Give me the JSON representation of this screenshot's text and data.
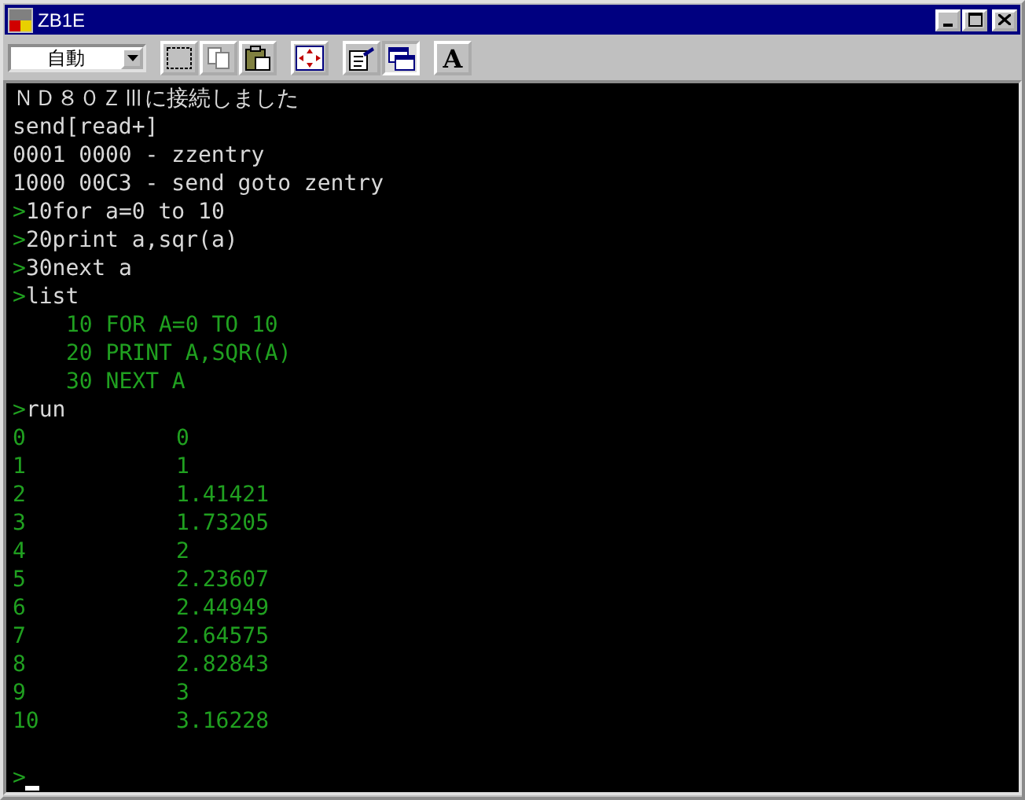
{
  "window": {
    "title": "ZB1E"
  },
  "toolbar": {
    "mode_dropdown": {
      "value": "自動"
    },
    "buttons": [
      {
        "kind": "select",
        "pressed": false
      },
      {
        "kind": "copy",
        "pressed": false
      },
      {
        "kind": "paste",
        "pressed": false
      },
      {
        "kind": "move",
        "pressed": false
      },
      {
        "kind": "properties",
        "pressed": false
      },
      {
        "kind": "window",
        "pressed": true
      },
      {
        "kind": "font",
        "label": "A",
        "pressed": false
      }
    ]
  },
  "terminal": {
    "lines": [
      {
        "kind": "system",
        "text": "ＮＤ８０ＺⅢに接続しました"
      },
      {
        "kind": "system",
        "text": "send[read+]"
      },
      {
        "kind": "system",
        "text": "0001 0000 - zzentry"
      },
      {
        "kind": "system",
        "text": "1000 00C3 - send goto zentry"
      },
      {
        "kind": "input",
        "prompt": ">",
        "text": "10for a=0 to 10"
      },
      {
        "kind": "input",
        "prompt": ">",
        "text": "20print a,sqr(a)"
      },
      {
        "kind": "input",
        "prompt": ">",
        "text": "30next a"
      },
      {
        "kind": "input",
        "prompt": ">",
        "text": "list"
      },
      {
        "kind": "listing",
        "text": "10 FOR A=0 TO 10"
      },
      {
        "kind": "listing",
        "text": "20 PRINT A,SQR(A)"
      },
      {
        "kind": "listing",
        "text": "30 NEXT A"
      },
      {
        "kind": "input",
        "prompt": ">",
        "text": "run"
      },
      {
        "kind": "output",
        "columns": [
          "0",
          "0"
        ]
      },
      {
        "kind": "output",
        "columns": [
          "1",
          "1"
        ]
      },
      {
        "kind": "output",
        "columns": [
          "2",
          "1.41421"
        ]
      },
      {
        "kind": "output",
        "columns": [
          "3",
          "1.73205"
        ]
      },
      {
        "kind": "output",
        "columns": [
          "4",
          "2"
        ]
      },
      {
        "kind": "output",
        "columns": [
          "5",
          "2.23607"
        ]
      },
      {
        "kind": "output",
        "columns": [
          "6",
          "2.44949"
        ]
      },
      {
        "kind": "output",
        "columns": [
          "7",
          "2.64575"
        ]
      },
      {
        "kind": "output",
        "columns": [
          "8",
          "2.82843"
        ]
      },
      {
        "kind": "output",
        "columns": [
          "9",
          "3"
        ]
      },
      {
        "kind": "output",
        "columns": [
          "10",
          "3.16228"
        ]
      },
      {
        "kind": "blank"
      },
      {
        "kind": "cursor",
        "prompt": ">"
      }
    ]
  }
}
